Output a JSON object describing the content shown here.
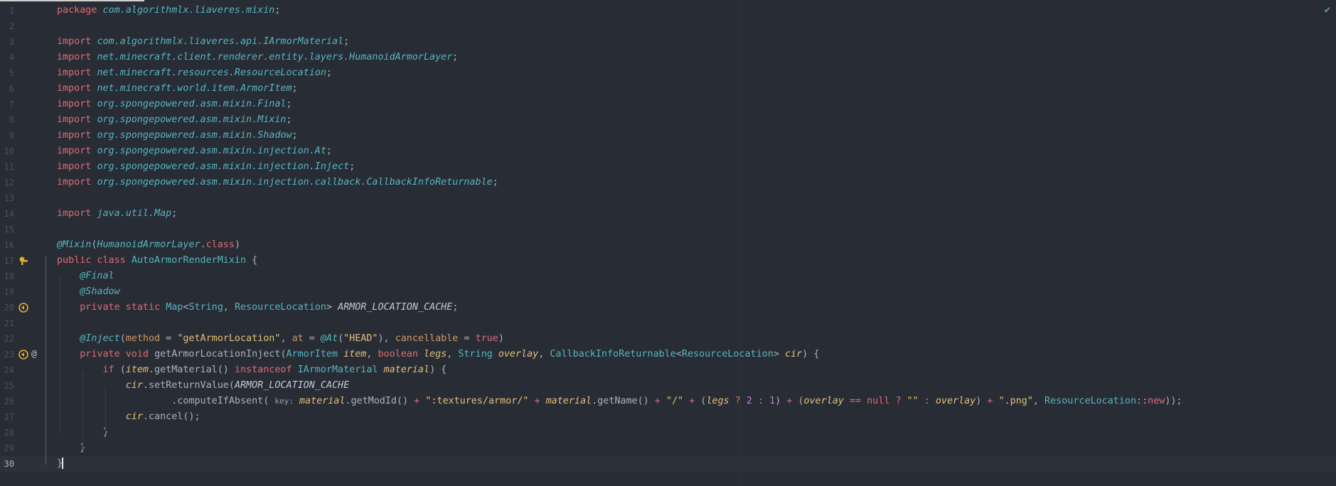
{
  "editor": {
    "status": "no-problems",
    "lines": [
      {
        "n": "1",
        "t": [
          [
            "kw",
            "package "
          ],
          [
            "pkg",
            "com.algorithmlx.liaveres.mixin"
          ],
          [
            "p",
            ";"
          ]
        ]
      },
      {
        "n": "2",
        "t": []
      },
      {
        "n": "3",
        "t": [
          [
            "kw",
            "import "
          ],
          [
            "pkg",
            "com.algorithmlx.liaveres.api.IArmorMaterial"
          ],
          [
            "p",
            ";"
          ]
        ]
      },
      {
        "n": "4",
        "t": [
          [
            "kw",
            "import "
          ],
          [
            "pkg",
            "net.minecraft.client.renderer.entity.layers.HumanoidArmorLayer"
          ],
          [
            "p",
            ";"
          ]
        ]
      },
      {
        "n": "5",
        "t": [
          [
            "kw",
            "import "
          ],
          [
            "pkg",
            "net.minecraft.resources.ResourceLocation"
          ],
          [
            "p",
            ";"
          ]
        ]
      },
      {
        "n": "6",
        "t": [
          [
            "kw",
            "import "
          ],
          [
            "pkg",
            "net.minecraft.world.item.ArmorItem"
          ],
          [
            "p",
            ";"
          ]
        ]
      },
      {
        "n": "7",
        "t": [
          [
            "kw",
            "import "
          ],
          [
            "pkg",
            "org.spongepowered.asm.mixin.Final"
          ],
          [
            "p",
            ";"
          ]
        ]
      },
      {
        "n": "8",
        "t": [
          [
            "kw",
            "import "
          ],
          [
            "pkg",
            "org.spongepowered.asm.mixin.Mixin"
          ],
          [
            "p",
            ";"
          ]
        ]
      },
      {
        "n": "9",
        "t": [
          [
            "kw",
            "import "
          ],
          [
            "pkg",
            "org.spongepowered.asm.mixin.Shadow"
          ],
          [
            "p",
            ";"
          ]
        ]
      },
      {
        "n": "10",
        "t": [
          [
            "kw",
            "import "
          ],
          [
            "pkg",
            "org.spongepowered.asm.mixin.injection.At"
          ],
          [
            "p",
            ";"
          ]
        ]
      },
      {
        "n": "11",
        "t": [
          [
            "kw",
            "import "
          ],
          [
            "pkg",
            "org.spongepowered.asm.mixin.injection.Inject"
          ],
          [
            "p",
            ";"
          ]
        ]
      },
      {
        "n": "12",
        "t": [
          [
            "kw",
            "import "
          ],
          [
            "pkg",
            "org.spongepowered.asm.mixin.injection.callback.CallbackInfoReturnable"
          ],
          [
            "p",
            ";"
          ]
        ]
      },
      {
        "n": "13",
        "t": []
      },
      {
        "n": "14",
        "t": [
          [
            "kw",
            "import "
          ],
          [
            "pkg",
            "java.util.Map"
          ],
          [
            "p",
            ";"
          ]
        ]
      },
      {
        "n": "15",
        "t": []
      },
      {
        "n": "16",
        "t": [
          [
            "ann",
            "@Mixin"
          ],
          [
            "p",
            "("
          ],
          [
            "typ",
            "HumanoidArmorLayer"
          ],
          [
            "p",
            "."
          ],
          [
            "kw",
            "class"
          ],
          [
            "p",
            ")"
          ]
        ]
      },
      {
        "n": "17",
        "icons": [
          "override"
        ],
        "t": [
          [
            "kw",
            "public class "
          ],
          [
            "cls",
            "AutoArmorRenderMixin "
          ],
          [
            "p",
            "{"
          ]
        ]
      },
      {
        "n": "18",
        "t": [
          [
            "p",
            "    "
          ],
          [
            "ann",
            "@Final"
          ]
        ]
      },
      {
        "n": "19",
        "t": [
          [
            "p",
            "    "
          ],
          [
            "ann",
            "@Shadow"
          ]
        ]
      },
      {
        "n": "20",
        "icons": [
          "navigate"
        ],
        "t": [
          [
            "p",
            "    "
          ],
          [
            "kw",
            "private static "
          ],
          [
            "cls",
            "Map"
          ],
          [
            "p",
            "<"
          ],
          [
            "cls",
            "String"
          ],
          [
            "p",
            ", "
          ],
          [
            "cls",
            "ResourceLocation"
          ],
          [
            "p",
            "> "
          ],
          [
            "field",
            "ARMOR_LOCATION_CACHE"
          ],
          [
            "p",
            ";"
          ]
        ]
      },
      {
        "n": "21",
        "t": []
      },
      {
        "n": "22",
        "t": [
          [
            "p",
            "    "
          ],
          [
            "ann",
            "@Inject"
          ],
          [
            "p",
            "("
          ],
          [
            "kwp",
            "method"
          ],
          [
            "p",
            " = "
          ],
          [
            "str",
            "\"getArmorLocation\""
          ],
          [
            "p",
            ", "
          ],
          [
            "kwp",
            "at"
          ],
          [
            "p",
            " = "
          ],
          [
            "ann",
            "@At"
          ],
          [
            "p",
            "("
          ],
          [
            "str",
            "\"HEAD\""
          ],
          [
            "p",
            "), "
          ],
          [
            "kwp",
            "cancellable"
          ],
          [
            "p",
            " = "
          ],
          [
            "kw",
            "true"
          ],
          [
            "p",
            ")"
          ]
        ]
      },
      {
        "n": "23",
        "icons": [
          "navigate",
          "at"
        ],
        "t": [
          [
            "p",
            "    "
          ],
          [
            "kw",
            "private void "
          ],
          [
            "fn",
            "getArmorLocationInject"
          ],
          [
            "p",
            "("
          ],
          [
            "cls",
            "ArmorItem "
          ],
          [
            "param",
            "item"
          ],
          [
            "p",
            ", "
          ],
          [
            "kw",
            "boolean "
          ],
          [
            "param",
            "legs"
          ],
          [
            "p",
            ", "
          ],
          [
            "cls",
            "String "
          ],
          [
            "param",
            "overlay"
          ],
          [
            "p",
            ", "
          ],
          [
            "cls",
            "CallbackInfoReturnable"
          ],
          [
            "p",
            "<"
          ],
          [
            "cls",
            "ResourceLocation"
          ],
          [
            "p",
            "> "
          ],
          [
            "param",
            "cir"
          ],
          [
            "p",
            ") {"
          ]
        ]
      },
      {
        "n": "24",
        "t": [
          [
            "p",
            "        "
          ],
          [
            "kw",
            "if "
          ],
          [
            "p",
            "("
          ],
          [
            "param",
            "item"
          ],
          [
            "p",
            ".getMaterial() "
          ],
          [
            "kw",
            "instanceof "
          ],
          [
            "cls",
            "IArmorMaterial "
          ],
          [
            "param",
            "material"
          ],
          [
            "p",
            ") {"
          ]
        ]
      },
      {
        "n": "25",
        "t": [
          [
            "p",
            "            "
          ],
          [
            "param",
            "cir"
          ],
          [
            "p",
            ".setReturnValue("
          ],
          [
            "field",
            "ARMOR_LOCATION_CACHE"
          ]
        ]
      },
      {
        "n": "26",
        "t": [
          [
            "p",
            "                    .computeIfAbsent( "
          ],
          [
            "hint",
            "key:"
          ],
          [
            "p",
            " "
          ],
          [
            "param",
            "material"
          ],
          [
            "p",
            ".getModId() "
          ],
          [
            "op",
            "+ "
          ],
          [
            "str",
            "\":textures/armor/\" "
          ],
          [
            "op",
            "+ "
          ],
          [
            "param",
            "material"
          ],
          [
            "p",
            ".getName() "
          ],
          [
            "op",
            "+ "
          ],
          [
            "str",
            "\"/\" "
          ],
          [
            "op",
            "+ "
          ],
          [
            "p",
            "("
          ],
          [
            "param",
            "legs "
          ],
          [
            "op",
            "? "
          ],
          [
            "num",
            "2 "
          ],
          [
            "op",
            ": "
          ],
          [
            "num",
            "1"
          ],
          [
            "p",
            ") "
          ],
          [
            "op",
            "+ "
          ],
          [
            "p",
            "("
          ],
          [
            "param",
            "overlay "
          ],
          [
            "op",
            "== "
          ],
          [
            "kw",
            "null "
          ],
          [
            "op",
            "? "
          ],
          [
            "str",
            "\"\" "
          ],
          [
            "op",
            ": "
          ],
          [
            "param",
            "overlay"
          ],
          [
            "p",
            ") "
          ],
          [
            "op",
            "+ "
          ],
          [
            "str",
            "\".png\""
          ],
          [
            "p",
            ", "
          ],
          [
            "cls",
            "ResourceLocation"
          ],
          [
            "p",
            "::"
          ],
          [
            "kw",
            "new"
          ],
          [
            "p",
            "));"
          ]
        ]
      },
      {
        "n": "27",
        "t": [
          [
            "p",
            "            "
          ],
          [
            "param",
            "cir"
          ],
          [
            "p",
            ".cancel();"
          ]
        ]
      },
      {
        "n": "28",
        "t": [
          [
            "p",
            "        }"
          ]
        ]
      },
      {
        "n": "29",
        "t": [
          [
            "p",
            "    }"
          ]
        ]
      },
      {
        "n": "30",
        "current": true,
        "t": [
          [
            "p",
            "}"
          ]
        ]
      }
    ]
  }
}
